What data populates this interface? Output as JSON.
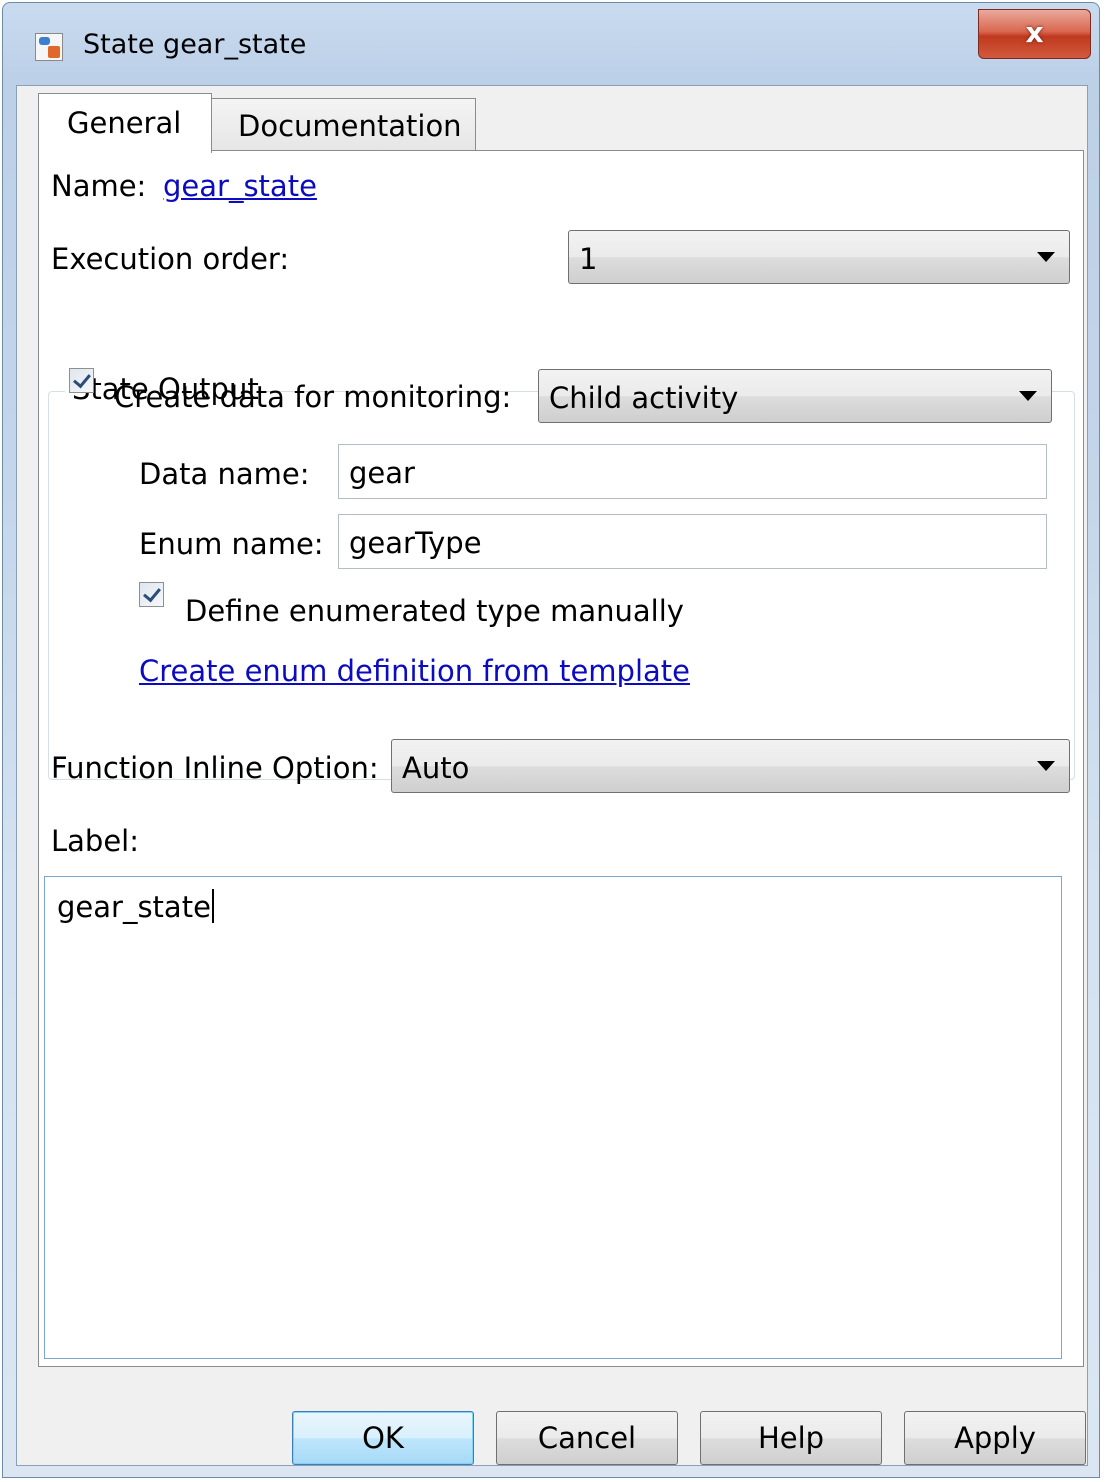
{
  "window": {
    "title": "State gear_state",
    "close_label": "x"
  },
  "tabs": [
    {
      "label": "General",
      "selected": true
    },
    {
      "label": "Documentation",
      "selected": false
    }
  ],
  "general": {
    "name_label": "Name:",
    "name_value": "gear_state",
    "execution_order_label": "Execution order:",
    "execution_order_value": "1",
    "state_output": {
      "title": "State Output",
      "create_data_label": "Create data for monitoring:",
      "create_data_checked": true,
      "monitoring_value": "Child activity",
      "data_name_label": "Data name:",
      "data_name_value": "gear",
      "enum_name_label": "Enum name:",
      "enum_name_value": "gearType",
      "define_enum_label": "Define enumerated type manually",
      "define_enum_checked": true,
      "template_link": "Create enum definition from template"
    },
    "function_inline_label": "Function Inline Option:",
    "function_inline_value": "Auto",
    "label_label": "Label:",
    "label_value": "gear_state"
  },
  "buttons": {
    "ok": "OK",
    "cancel": "Cancel",
    "help": "Help",
    "apply": "Apply"
  },
  "icons": [
    "stateflow-state-icon",
    "close-icon",
    "dropdown-arrow-icon",
    "checkmark-icon"
  ],
  "colors": {
    "link": "#0b0bbf",
    "close_button": "#c0391f",
    "default_button_border": "#3c7fb1",
    "window_frame": "#c3d5ea"
  }
}
